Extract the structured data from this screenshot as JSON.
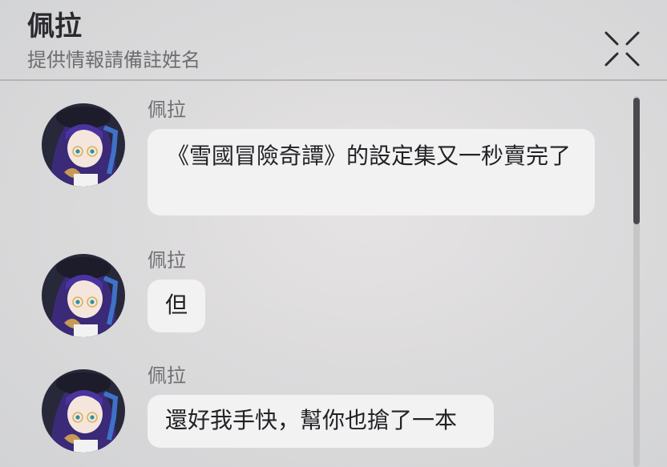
{
  "header": {
    "title": "佩拉",
    "subtitle": "提供情報請備註姓名",
    "close_icon": "close-x-icon"
  },
  "messages": [
    {
      "sender": "佩拉",
      "text": "《雪國冒險奇譚》的設定集又一秒賣完了"
    },
    {
      "sender": "佩拉",
      "text": "但"
    },
    {
      "sender": "佩拉",
      "text": "還好我手快，幫你也搶了一本"
    }
  ],
  "colors": {
    "bubble": "#f2f2f3",
    "title": "#2a2a2e",
    "subtitle": "#6d6d72",
    "avatar_hair": "#3b2a78",
    "scrollbar": "#4a4a4e"
  }
}
